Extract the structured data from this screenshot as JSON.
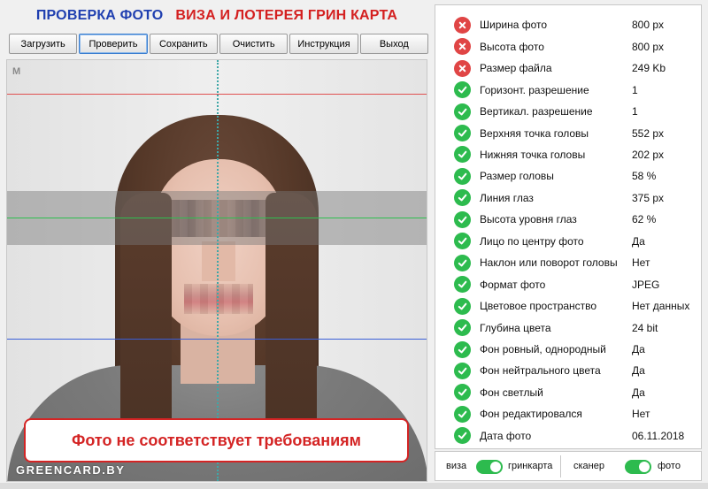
{
  "header": {
    "title_left": "ПРОВЕРКА ФОТО",
    "title_right": "ВИЗА И ЛОТЕРЕЯ ГРИН КАРТА",
    "color_left": "#1f3fb0",
    "color_right": "#d42020"
  },
  "toolbar": {
    "buttons": [
      {
        "label": "Загрузить"
      },
      {
        "label": "Проверить"
      },
      {
        "label": "Сохранить"
      },
      {
        "label": "Очистить"
      },
      {
        "label": "Инструкция"
      },
      {
        "label": "Выход"
      }
    ]
  },
  "photo": {
    "marker": "M",
    "status_message": "Фото не соответствует требованиям",
    "watermark": "GREENCARD.BY"
  },
  "checks": [
    {
      "label": "Ширина фото",
      "value": "800 px",
      "status": "fail"
    },
    {
      "label": "Высота фото",
      "value": "800 px",
      "status": "fail"
    },
    {
      "label": "Размер файла",
      "value": "249 Kb",
      "status": "fail"
    },
    {
      "label": "Горизонт. разрешение",
      "value": "1",
      "status": "pass"
    },
    {
      "label": "Вертикал. разрешение",
      "value": "1",
      "status": "pass"
    },
    {
      "label": "Верхняя точка головы",
      "value": "552 px",
      "status": "pass"
    },
    {
      "label": "Нижняя точка головы",
      "value": "202 px",
      "status": "pass"
    },
    {
      "label": "Размер головы",
      "value": "58 %",
      "status": "pass"
    },
    {
      "label": "Линия глаз",
      "value": "375 px",
      "status": "pass"
    },
    {
      "label": "Высота уровня глаз",
      "value": "62 %",
      "status": "pass"
    },
    {
      "label": "Лицо по центру фото",
      "value": "Да",
      "status": "pass"
    },
    {
      "label": "Наклон или поворот головы",
      "value": "Нет",
      "status": "pass"
    },
    {
      "label": "Формат фото",
      "value": "JPEG",
      "status": "pass"
    },
    {
      "label": "Цветовое пространство",
      "value": "Нет данных",
      "status": "pass"
    },
    {
      "label": "Глубина цвета",
      "value": "24 bit",
      "status": "pass"
    },
    {
      "label": "Фон ровный, однородный",
      "value": "Да",
      "status": "pass"
    },
    {
      "label": "Фон нейтрального цвета",
      "value": "Да",
      "status": "pass"
    },
    {
      "label": "Фон светлый",
      "value": "Да",
      "status": "pass"
    },
    {
      "label": "Фон редактировался",
      "value": "Нет",
      "status": "pass"
    },
    {
      "label": "Дата фото",
      "value": "06.11.2018",
      "status": "pass"
    }
  ],
  "toggles": {
    "mode_left_label": "виза",
    "mode_right_label": "гринкарта",
    "source_left_label": "сканер",
    "source_right_label": "фото",
    "mode_on": true,
    "source_on": true
  },
  "colors": {
    "pass": "#2dbb4e",
    "fail": "#e04545",
    "top_line": "#e05050",
    "eye_line": "#2fbf4f",
    "chin_line": "#3a5fd8",
    "center_line": "#3fa7a7"
  }
}
